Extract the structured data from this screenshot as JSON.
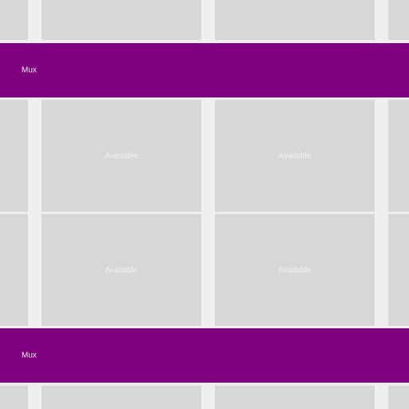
{
  "theme": {
    "background": "#efefef",
    "cell_color": "#d7d7d7",
    "mux_color": "#7f007f",
    "label_color": "#f2f2f2"
  },
  "mux_bars": [
    {
      "label": "Mux"
    },
    {
      "label": "Mux"
    }
  ],
  "available_cells": [
    {
      "label": "Available"
    },
    {
      "label": "Available"
    },
    {
      "label": "Available"
    },
    {
      "label": "Available"
    }
  ]
}
